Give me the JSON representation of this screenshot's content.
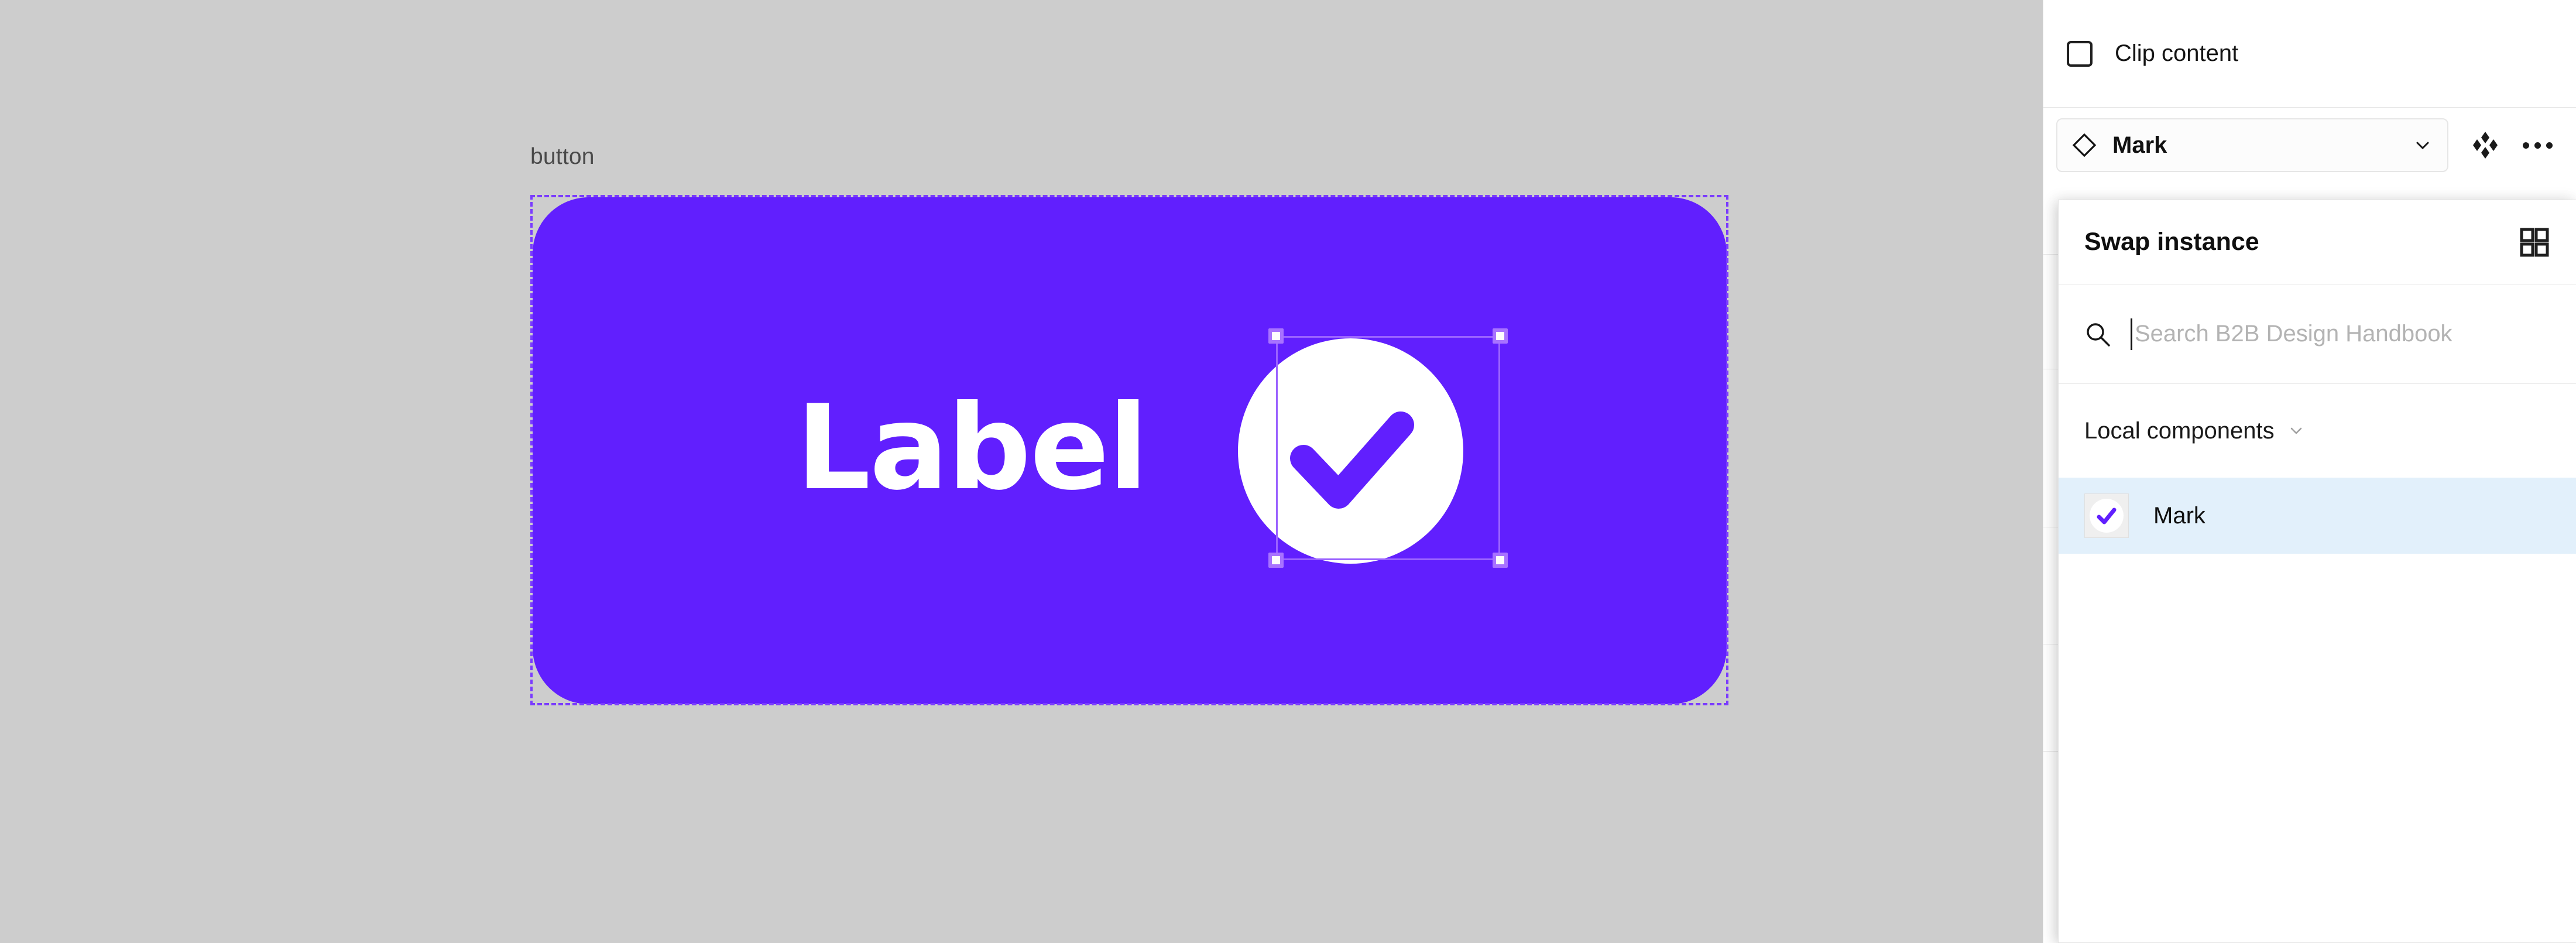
{
  "canvas": {
    "background_color": "#cdcdcd",
    "frame_name": "button",
    "button": {
      "label": "Label",
      "fill_color": "#611ffe",
      "icon_name": "check-circle-icon",
      "selection_color": "#7a3bff"
    }
  },
  "right_panel": {
    "clip_content": {
      "label": "Clip content",
      "checked": false
    },
    "instance": {
      "icon_name": "diamond-icon",
      "name": "Mark",
      "chevron_icon": "chevron-down-icon",
      "swap_icon": "swap-instance-icon",
      "more_icon": "more-horizontal-icon"
    }
  },
  "swap_popover": {
    "title": "Swap instance",
    "grid_view_icon": "grid-view-icon",
    "search": {
      "icon_name": "search-icon",
      "placeholder": "Search B2B Design Handbook",
      "value": ""
    },
    "sections": [
      {
        "label": "Local components",
        "chevron_icon": "chevron-down-icon",
        "expanded": true,
        "items": [
          {
            "name": "Mark",
            "thumbnail_icon": "check-circle-icon",
            "selected": true,
            "highlight_color": "#e2f0fb"
          }
        ]
      }
    ]
  }
}
